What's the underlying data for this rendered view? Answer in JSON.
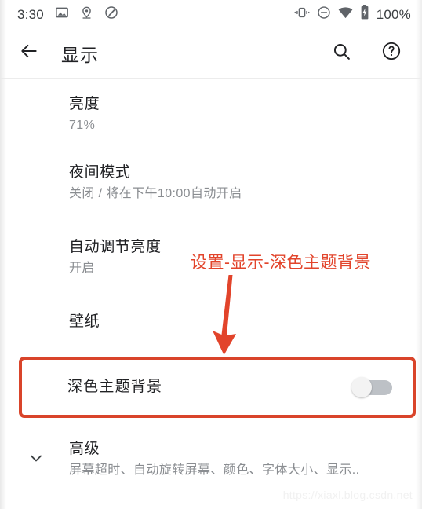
{
  "status_bar": {
    "time": "3:30",
    "battery_percent": "100%",
    "left_icons": [
      {
        "name": "image-icon"
      },
      {
        "name": "location-pin-icon"
      },
      {
        "name": "do-not-disturb-slash-icon"
      }
    ],
    "right_icons": [
      {
        "name": "vibrate-icon"
      },
      {
        "name": "dnd-minus-circle-icon"
      },
      {
        "name": "wifi-icon"
      },
      {
        "name": "battery-charging-icon"
      }
    ]
  },
  "app_bar": {
    "title": "显示",
    "back_icon": "back-arrow-icon",
    "search_icon": "search-icon",
    "help_icon": "help-circle-icon"
  },
  "settings": {
    "items": [
      {
        "title": "亮度",
        "subtitle": "71%"
      },
      {
        "title": "夜间模式",
        "subtitle": "关闭 / 将在下午10:00自动开启"
      },
      {
        "title": "自动调节亮度",
        "subtitle": "开启"
      },
      {
        "title": "壁纸",
        "subtitle": ""
      }
    ],
    "dark_theme": {
      "title": "深色主题背景",
      "toggle_state": "off"
    },
    "advanced": {
      "title": "高级",
      "subtitle": "屏幕超时、自动旋转屏幕、颜色、字体大小、显示..",
      "chevron_icon": "chevron-down-icon"
    }
  },
  "annotation": {
    "text": "设置-显示-深色主题背景",
    "color": "#e2442b",
    "arrow_icon": "down-arrow-annotation-icon",
    "highlight_color": "#d9442a"
  },
  "watermark": {
    "text": "https://xiaxl.blog.csdn.net"
  }
}
